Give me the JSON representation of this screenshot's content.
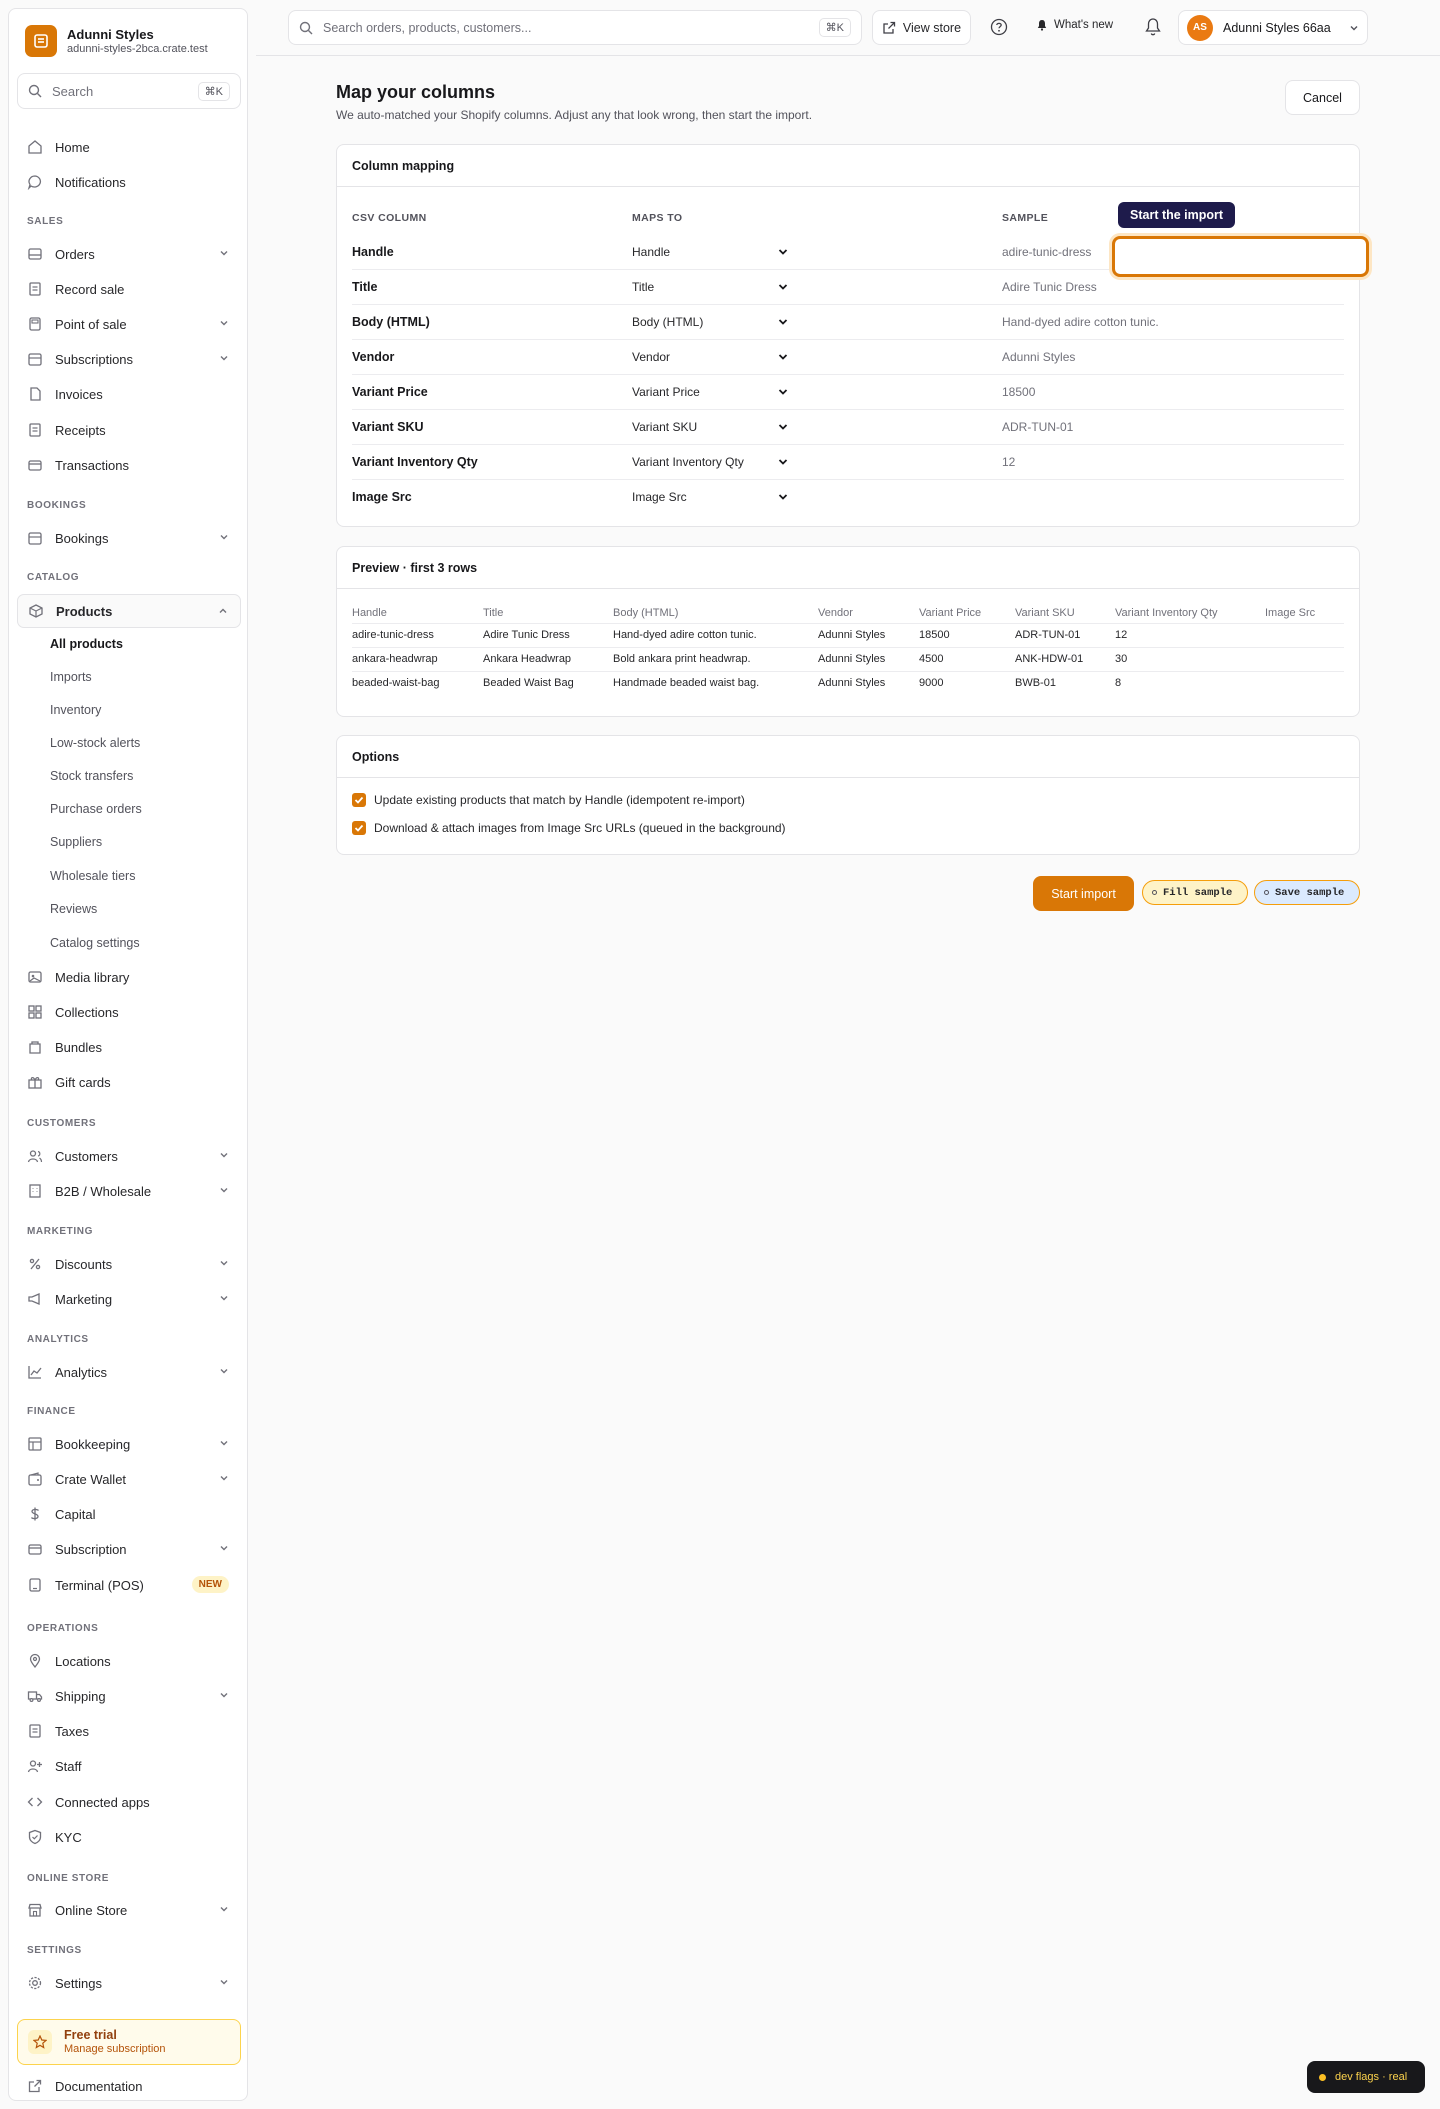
{
  "store": {
    "name": "Adunni Styles",
    "domain": "adunni-styles-2bca.crate.test"
  },
  "sidebar_search": {
    "placeholder": "Search",
    "shortcut": "⌘K"
  },
  "nav": {
    "home": "Home",
    "notifications": "Notifications",
    "sales_label": "SALES",
    "orders": "Orders",
    "record_sale": "Record sale",
    "point_of_sale": "Point of sale",
    "subscriptions": "Subscriptions",
    "invoices": "Invoices",
    "receipts": "Receipts",
    "transactions": "Transactions",
    "bookings_label": "BOOKINGS",
    "bookings": "Bookings",
    "catalog_label": "CATALOG",
    "products": "Products",
    "products_sub": [
      "All products",
      "Imports",
      "Inventory",
      "Low-stock alerts",
      "Stock transfers",
      "Purchase orders",
      "Suppliers",
      "Wholesale tiers",
      "Reviews",
      "Catalog settings"
    ],
    "media_library": "Media library",
    "collections": "Collections",
    "bundles": "Bundles",
    "gift_cards": "Gift cards",
    "customers_label": "CUSTOMERS",
    "customers": "Customers",
    "b2b": "B2B / Wholesale",
    "marketing_label": "MARKETING",
    "discounts": "Discounts",
    "marketing": "Marketing",
    "analytics_label": "ANALYTICS",
    "analytics": "Analytics",
    "finance_label": "FINANCE",
    "bookkeeping": "Bookkeeping",
    "crate_wallet": "Crate Wallet",
    "capital": "Capital",
    "subscription": "Subscription",
    "terminal": "Terminal (POS)",
    "new_badge": "NEW",
    "operations_label": "OPERATIONS",
    "locations": "Locations",
    "shipping": "Shipping",
    "taxes": "Taxes",
    "staff": "Staff",
    "connected_apps": "Connected apps",
    "kyc": "KYC",
    "online_store_label": "ONLINE STORE",
    "online_store": "Online Store",
    "settings_label": "SETTINGS",
    "settings": "Settings"
  },
  "trial": {
    "title": "Free trial",
    "link": "Manage subscription"
  },
  "documentation": "Documentation",
  "topbar": {
    "search_placeholder": "Search orders, products, customers...",
    "search_shortcut": "⌘K",
    "view_store": "View store",
    "whats_new": "What's new",
    "avatar_initials": "AS",
    "account_name": "Adunni Styles 66aa"
  },
  "page": {
    "title": "Map your columns",
    "subtitle": "We auto-matched your Shopify columns. Adjust any that look wrong, then start the import.",
    "cancel": "Cancel"
  },
  "mapping": {
    "card_title": "Column mapping",
    "headers": {
      "csv": "CSV COLUMN",
      "maps_to": "MAPS TO",
      "sample": "SAMPLE"
    },
    "rows": [
      {
        "csv": "Handle",
        "maps_to": "Handle",
        "sample": "adire-tunic-dress"
      },
      {
        "csv": "Title",
        "maps_to": "Title",
        "sample": "Adire Tunic Dress"
      },
      {
        "csv": "Body (HTML)",
        "maps_to": "Body (HTML)",
        "sample": "Hand-dyed adire cotton tunic."
      },
      {
        "csv": "Vendor",
        "maps_to": "Vendor",
        "sample": "Adunni Styles"
      },
      {
        "csv": "Variant Price",
        "maps_to": "Variant Price",
        "sample": "18500"
      },
      {
        "csv": "Variant SKU",
        "maps_to": "Variant SKU",
        "sample": "ADR-TUN-01"
      },
      {
        "csv": "Variant Inventory Qty",
        "maps_to": "Variant Inventory Qty",
        "sample": "12"
      },
      {
        "csv": "Image Src",
        "maps_to": "Image Src",
        "sample": ""
      }
    ]
  },
  "tooltip": "Start the import",
  "preview": {
    "card_title": "Preview · first 3 rows",
    "headers": [
      "Handle",
      "Title",
      "Body (HTML)",
      "Vendor",
      "Variant Price",
      "Variant SKU",
      "Variant Inventory Qty",
      "Image Src"
    ],
    "rows": [
      [
        "adire-tunic-dress",
        "Adire Tunic Dress",
        "Hand-dyed adire cotton tunic.",
        "Adunni Styles",
        "18500",
        "ADR-TUN-01",
        "12",
        ""
      ],
      [
        "ankara-headwrap",
        "Ankara Headwrap",
        "Bold ankara print headwrap.",
        "Adunni Styles",
        "4500",
        "ANK-HDW-01",
        "30",
        ""
      ],
      [
        "beaded-waist-bag",
        "Beaded Waist Bag",
        "Handmade beaded waist bag.",
        "Adunni Styles",
        "9000",
        "BWB-01",
        "8",
        ""
      ]
    ]
  },
  "options": {
    "card_title": "Options",
    "update_existing": "Update existing products that match by Handle (idempotent re-import)",
    "download_images": "Download & attach images from Image Src URLs (queued in the background)"
  },
  "actions": {
    "start_import": "Start import",
    "fill_sample": "Fill sample",
    "save_sample": "Save sample"
  },
  "dev_flags": "dev flags · real",
  "colors": {
    "accent": "#d97706",
    "tooltip_bg": "#1e1b4b"
  }
}
